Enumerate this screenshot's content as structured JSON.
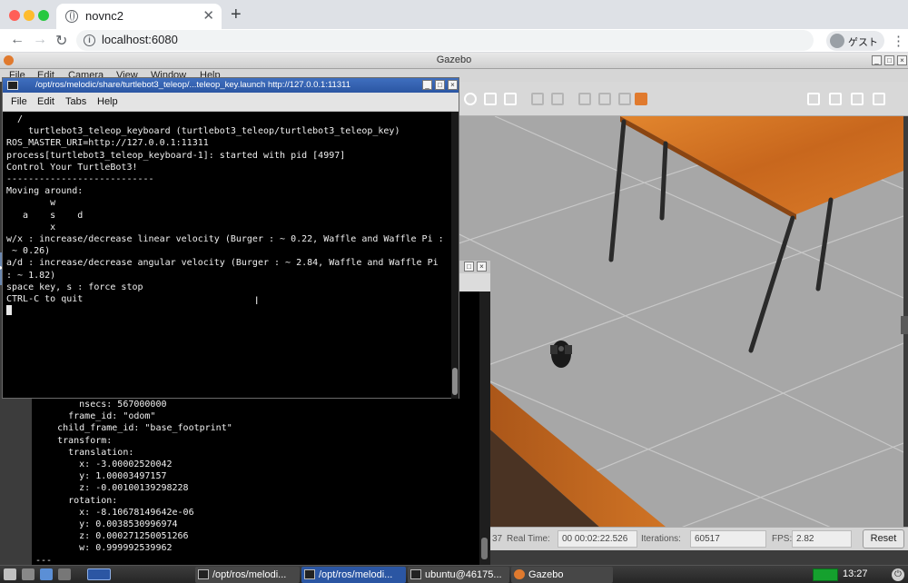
{
  "browser": {
    "tab_title": "novnc2",
    "tab_close": "✕",
    "new_tab": "+",
    "back": "←",
    "forward": "→",
    "reload": "↻",
    "url": "localhost:6080",
    "profile_label": "ゲスト",
    "menu": "⋮"
  },
  "gazebo": {
    "window_title": "Gazebo",
    "menu": [
      "File",
      "Edit",
      "Camera",
      "View",
      "Window",
      "Help"
    ],
    "status": {
      "real_time_label": "Real Time:",
      "real_time_value": "00 00:02:22.526",
      "iterations_label": "Iterations:",
      "iterations_value": "60517",
      "fps_label": "FPS:",
      "fps_value": "2.82",
      "reset_label": "Reset",
      "left_fragment": "37"
    }
  },
  "front_terminal": {
    "title": "/opt/ros/melodic/share/turtlebot3_teleop/...teleop_key.launch http://127.0.0.1:11311",
    "menu": [
      "File",
      "Edit",
      "Tabs",
      "Help"
    ],
    "lines": [
      "  /",
      "    turtlebot3_teleop_keyboard (turtlebot3_teleop/turtlebot3_teleop_key)",
      "",
      "ROS_MASTER_URI=http://127.0.0.1:11311",
      "",
      "process[turtlebot3_teleop_keyboard-1]: started with pid [4997]",
      "",
      "Control Your TurtleBot3!",
      "---------------------------",
      "Moving around:",
      "        w",
      "   a    s    d",
      "        x",
      "",
      "w/x : increase/decrease linear velocity (Burger : ~ 0.22, Waffle and Waffle Pi :",
      " ~ 0.26)",
      "a/d : increase/decrease angular velocity (Burger : ~ 2.84, Waffle and Waffle Pi",
      ": ~ 1.82)",
      "",
      "space key, s : force stop",
      "",
      "CTRL-C to quit",
      ""
    ]
  },
  "back_terminal": {
    "lines": [
      "        nsecs: 567000000",
      "      frame_id: \"odom\"",
      "    child_frame_id: \"base_footprint\"",
      "    transform:",
      "      translation:",
      "        x: -3.00002520042",
      "        y: 1.00003497157",
      "        z: -0.00100139298228",
      "      rotation:",
      "        x: -8.10678149642e-06",
      "        y: 0.0038530996974",
      "        z: 0.000271250051266",
      "        w: 0.999992539962",
      "---"
    ]
  },
  "taskbar": {
    "tasks": [
      "/opt/ros/melodi...",
      "/opt/ros/melodi...",
      "ubuntu@46175...",
      "Gazebo"
    ],
    "clock": "13:27",
    "power": "⏻"
  },
  "colors": {
    "terminal_bg": "#000000",
    "terminal_title_active": "#3f6fbf",
    "wood": "#c96a1e",
    "ground": "#a7a7a7"
  }
}
